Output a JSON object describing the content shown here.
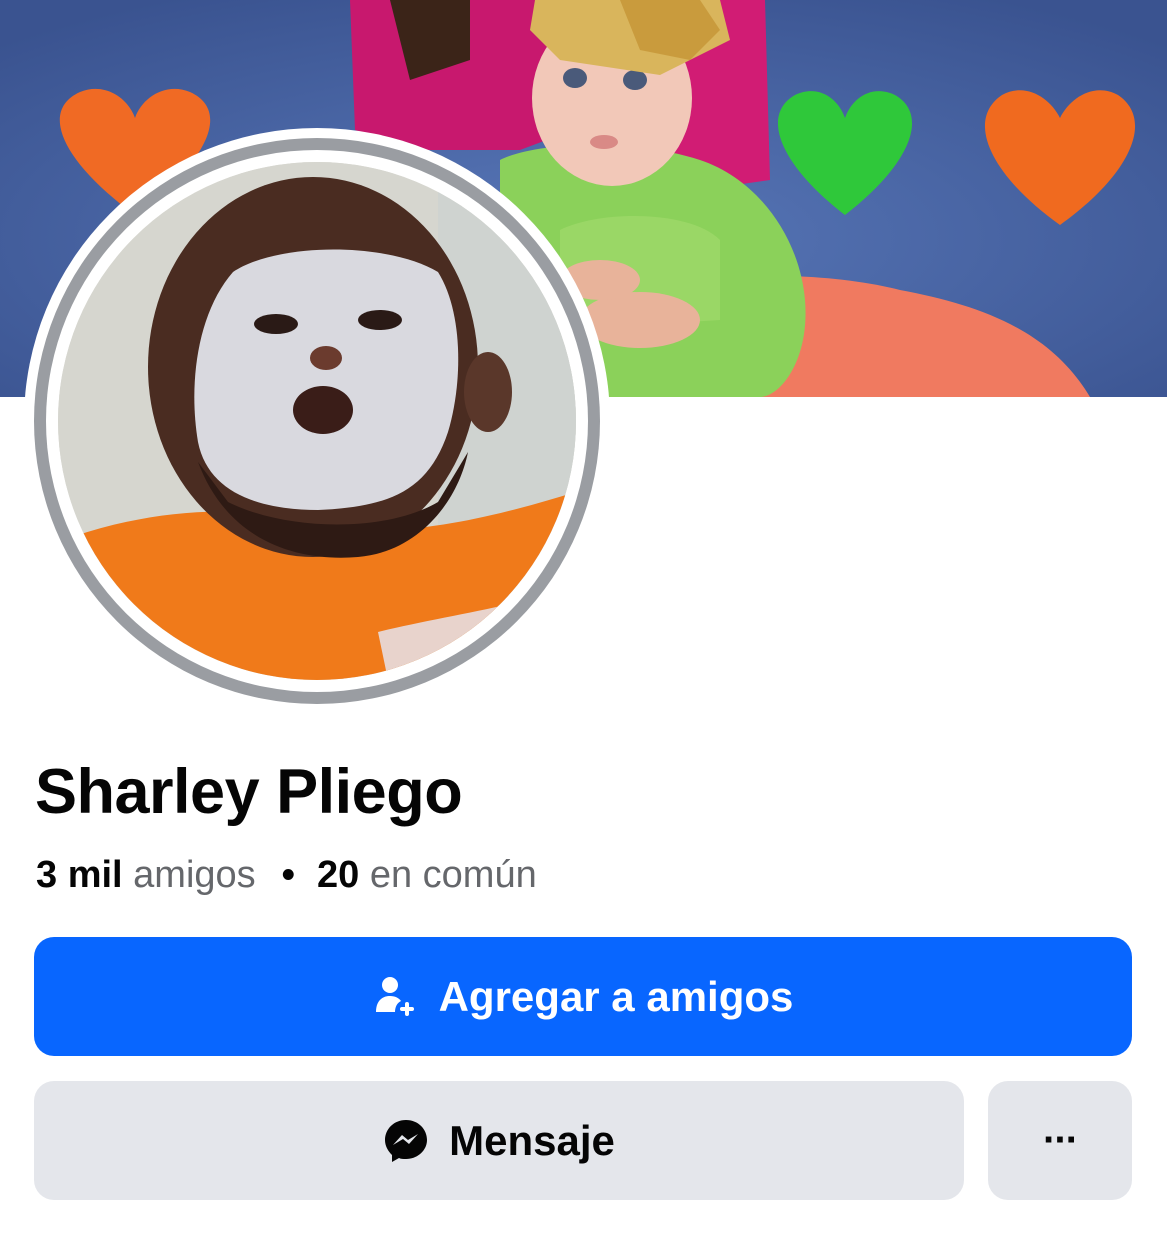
{
  "profile": {
    "name": "Sharley Pliego",
    "friends_count": "3 mil",
    "friends_label": "amigos",
    "separator": "•",
    "mutual_count": "20",
    "mutual_label": "en común"
  },
  "actions": {
    "add_friend_label": "Agregar a amigos",
    "add_friend_icon": "add-person-icon",
    "message_label": "Mensaje",
    "message_icon": "messenger-icon",
    "more_label": "···"
  },
  "colors": {
    "primary": "#0866ff",
    "secondary_button": "#e4e6eb",
    "text_primary": "#050505",
    "text_secondary": "#65676b"
  }
}
